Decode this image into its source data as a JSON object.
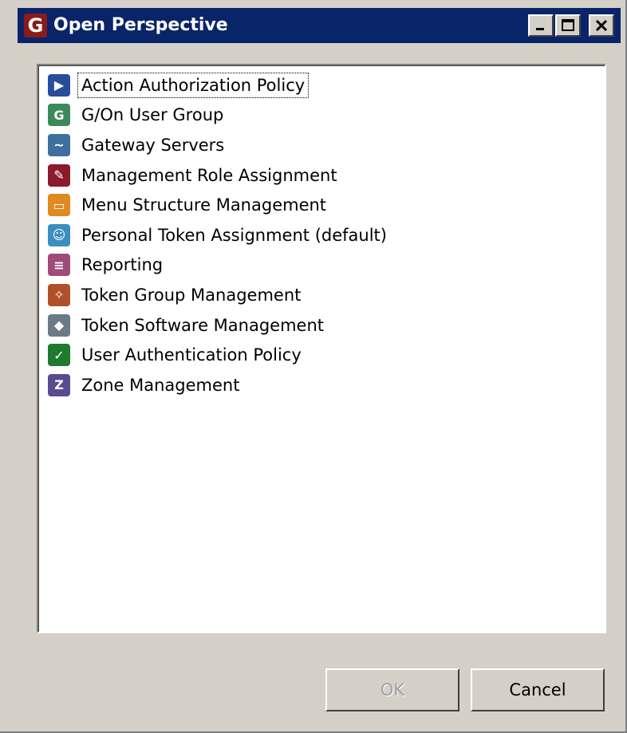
{
  "window": {
    "title": "Open Perspective",
    "app_icon_letter": "G"
  },
  "titlebar_buttons": [
    "minimize",
    "maximize",
    "close"
  ],
  "perspectives": [
    {
      "label": "Action Authorization Policy",
      "icon": "play-icon",
      "color": "#2a4d9b",
      "glyph": "▶",
      "selected": true
    },
    {
      "label": "G/On User Group",
      "icon": "user-group-icon",
      "color": "#3c8a5a",
      "glyph": "G"
    },
    {
      "label": "Gateway Servers",
      "icon": "pulse-icon",
      "color": "#3f6f9e",
      "glyph": "~"
    },
    {
      "label": "Management Role Assignment",
      "icon": "pencil-icon",
      "color": "#8b1a2a",
      "glyph": "✎"
    },
    {
      "label": "Menu Structure Management",
      "icon": "folder-icon",
      "color": "#e08a20",
      "glyph": "▭"
    },
    {
      "label": "Personal Token Assignment (default)",
      "icon": "users-icon",
      "color": "#3a8fbf",
      "glyph": "☺"
    },
    {
      "label": "Reporting",
      "icon": "document-icon",
      "color": "#a04a7a",
      "glyph": "≡"
    },
    {
      "label": "Token Group Management",
      "icon": "wrench-icon",
      "color": "#b0502a",
      "glyph": "✧"
    },
    {
      "label": "Token Software Management",
      "icon": "box-icon",
      "color": "#6a7a86",
      "glyph": "◆"
    },
    {
      "label": "User Authentication Policy",
      "icon": "checkmark-icon",
      "color": "#1e7a2e",
      "glyph": "✓"
    },
    {
      "label": "Zone Management",
      "icon": "zone-icon",
      "color": "#5a4a8f",
      "glyph": "Z"
    }
  ],
  "buttons": {
    "ok": "OK",
    "cancel": "Cancel"
  }
}
